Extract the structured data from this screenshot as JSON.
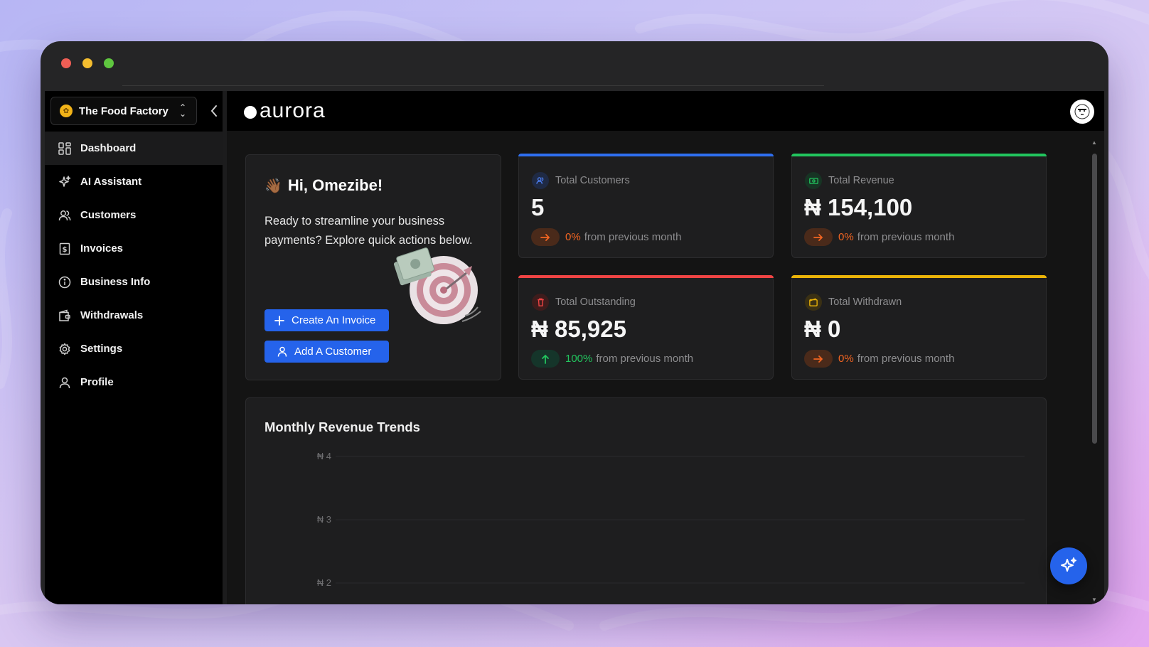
{
  "window": {
    "controls": [
      "close",
      "minimize",
      "maximize"
    ]
  },
  "sidebar": {
    "org": {
      "name": "The Food Factory",
      "icon": "org-logo-icon"
    },
    "collapse_icon": "chevron-left-icon",
    "items": [
      {
        "label": "Dashboard",
        "icon": "grid-icon",
        "active": true
      },
      {
        "label": "AI Assistant",
        "icon": "sparkle-icon"
      },
      {
        "label": "Customers",
        "icon": "users-icon"
      },
      {
        "label": "Invoices",
        "icon": "invoice-icon"
      },
      {
        "label": "Business Info",
        "icon": "info-icon"
      },
      {
        "label": "Withdrawals",
        "icon": "wallet-icon"
      },
      {
        "label": "Settings",
        "icon": "gear-icon"
      },
      {
        "label": "Profile",
        "icon": "user-icon"
      }
    ]
  },
  "header": {
    "brand": "aurora",
    "avatar_icon": "avatar-icon"
  },
  "welcome": {
    "greeting": "Hi, Omezibe!",
    "wave_emoji": "👋🏾",
    "message": "Ready to streamline your business payments? Explore quick actions below.",
    "create_invoice": "Create An Invoice",
    "add_customer": "Add A Customer"
  },
  "stats": [
    {
      "label": "Total Customers",
      "value": "5",
      "change": "0%",
      "suffix": "from previous month",
      "accent": "#2f6ff0",
      "trend_color": "#f26522",
      "trend": "flat"
    },
    {
      "label": "Total Revenue",
      "value": "₦ 154,100",
      "change": "0%",
      "suffix": "from previous month",
      "accent": "#22c55e",
      "trend_color": "#f26522",
      "trend": "flat"
    },
    {
      "label": "Total Outstanding",
      "value": "₦ 85,925",
      "change": "100%",
      "suffix": "from previous month",
      "accent": "#ef4444",
      "trend_color": "#22c55e",
      "trend": "up"
    },
    {
      "label": "Total Withdrawn",
      "value": "₦ 0",
      "change": "0%",
      "suffix": "from previous month",
      "accent": "#eab308",
      "trend_color": "#f26522",
      "trend": "flat"
    }
  ],
  "chart_data": {
    "type": "line",
    "title": "Monthly Revenue Trends",
    "y_ticks": [
      "₦ 4",
      "₦ 3",
      "₦ 2"
    ],
    "ylim": [
      2,
      4
    ],
    "grid": true,
    "series": []
  },
  "fab": {
    "icon": "sparkle-icon"
  }
}
